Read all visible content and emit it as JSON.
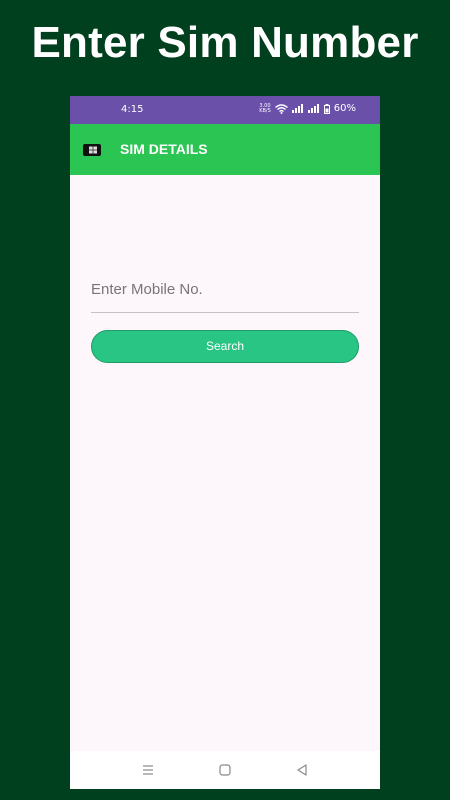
{
  "headline": "Enter Sim Number",
  "status_bar": {
    "time": "4:15",
    "speed_value": "3.00",
    "speed_unit": "KB/S",
    "battery": "60%"
  },
  "app_bar": {
    "title": "SIM DETAILS",
    "icon": "sim-card-icon"
  },
  "form": {
    "mobile_value": "",
    "mobile_placeholder": "Enter Mobile No.",
    "search_label": "Search"
  },
  "nav_bar": {
    "icons": [
      "menu-icon",
      "home-square-icon",
      "back-triangle-icon"
    ]
  },
  "colors": {
    "background": "#01401f",
    "status_bar": "#6a50a9",
    "app_bar": "#2ac553",
    "button": "#28c584",
    "screen": "#fdf6fb"
  }
}
